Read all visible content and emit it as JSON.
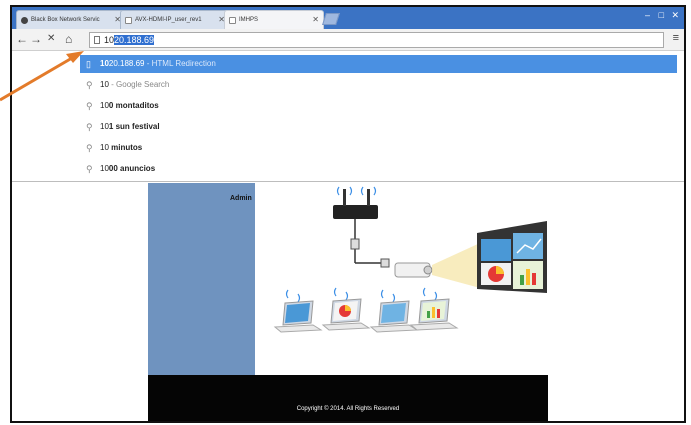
{
  "tabs": [
    {
      "label": "Black Box Network Servic",
      "active": false
    },
    {
      "label": "AVX-HDMI-IP_user_rev1",
      "active": false
    },
    {
      "label": "IMHPS",
      "active": true
    }
  ],
  "toolbar": {
    "back": "←",
    "forward": "→",
    "stop": "✕",
    "home": "⌂",
    "address_typed": "10",
    "address_autocomplete": "20.188.69",
    "menu": "≡"
  },
  "window_controls": {
    "minimize": "–",
    "maximize": "□",
    "close": "✕"
  },
  "suggestions": [
    {
      "prefix": "10",
      "rest": "20.188.69",
      "desc": " - HTML Redirection",
      "icon": "page-icon",
      "highlighted": true
    },
    {
      "prefix": "10",
      "rest": "",
      "desc": " - Google Search",
      "icon": "search-icon",
      "highlighted": false
    },
    {
      "prefix": "10",
      "rest": "0 montaditos",
      "desc": "",
      "icon": "search-icon",
      "highlighted": false
    },
    {
      "prefix": "10",
      "rest": "1 sun festival",
      "desc": "",
      "icon": "search-icon",
      "highlighted": false
    },
    {
      "prefix": "10",
      "rest": " minutos",
      "desc": "",
      "icon": "search-icon",
      "highlighted": false
    },
    {
      "prefix": "10",
      "rest": "00 anuncios",
      "desc": "",
      "icon": "search-icon",
      "highlighted": false
    }
  ],
  "page": {
    "admin_label": "Admin",
    "copyright": "Copyright © 2014. All Rights Reserved"
  },
  "colors": {
    "tabstrip": "#3b73c4",
    "highlight": "#4a90e2",
    "sidebar": "#6f93bf",
    "footer": "#050505",
    "annotation_arrow": "#e37b2a"
  }
}
